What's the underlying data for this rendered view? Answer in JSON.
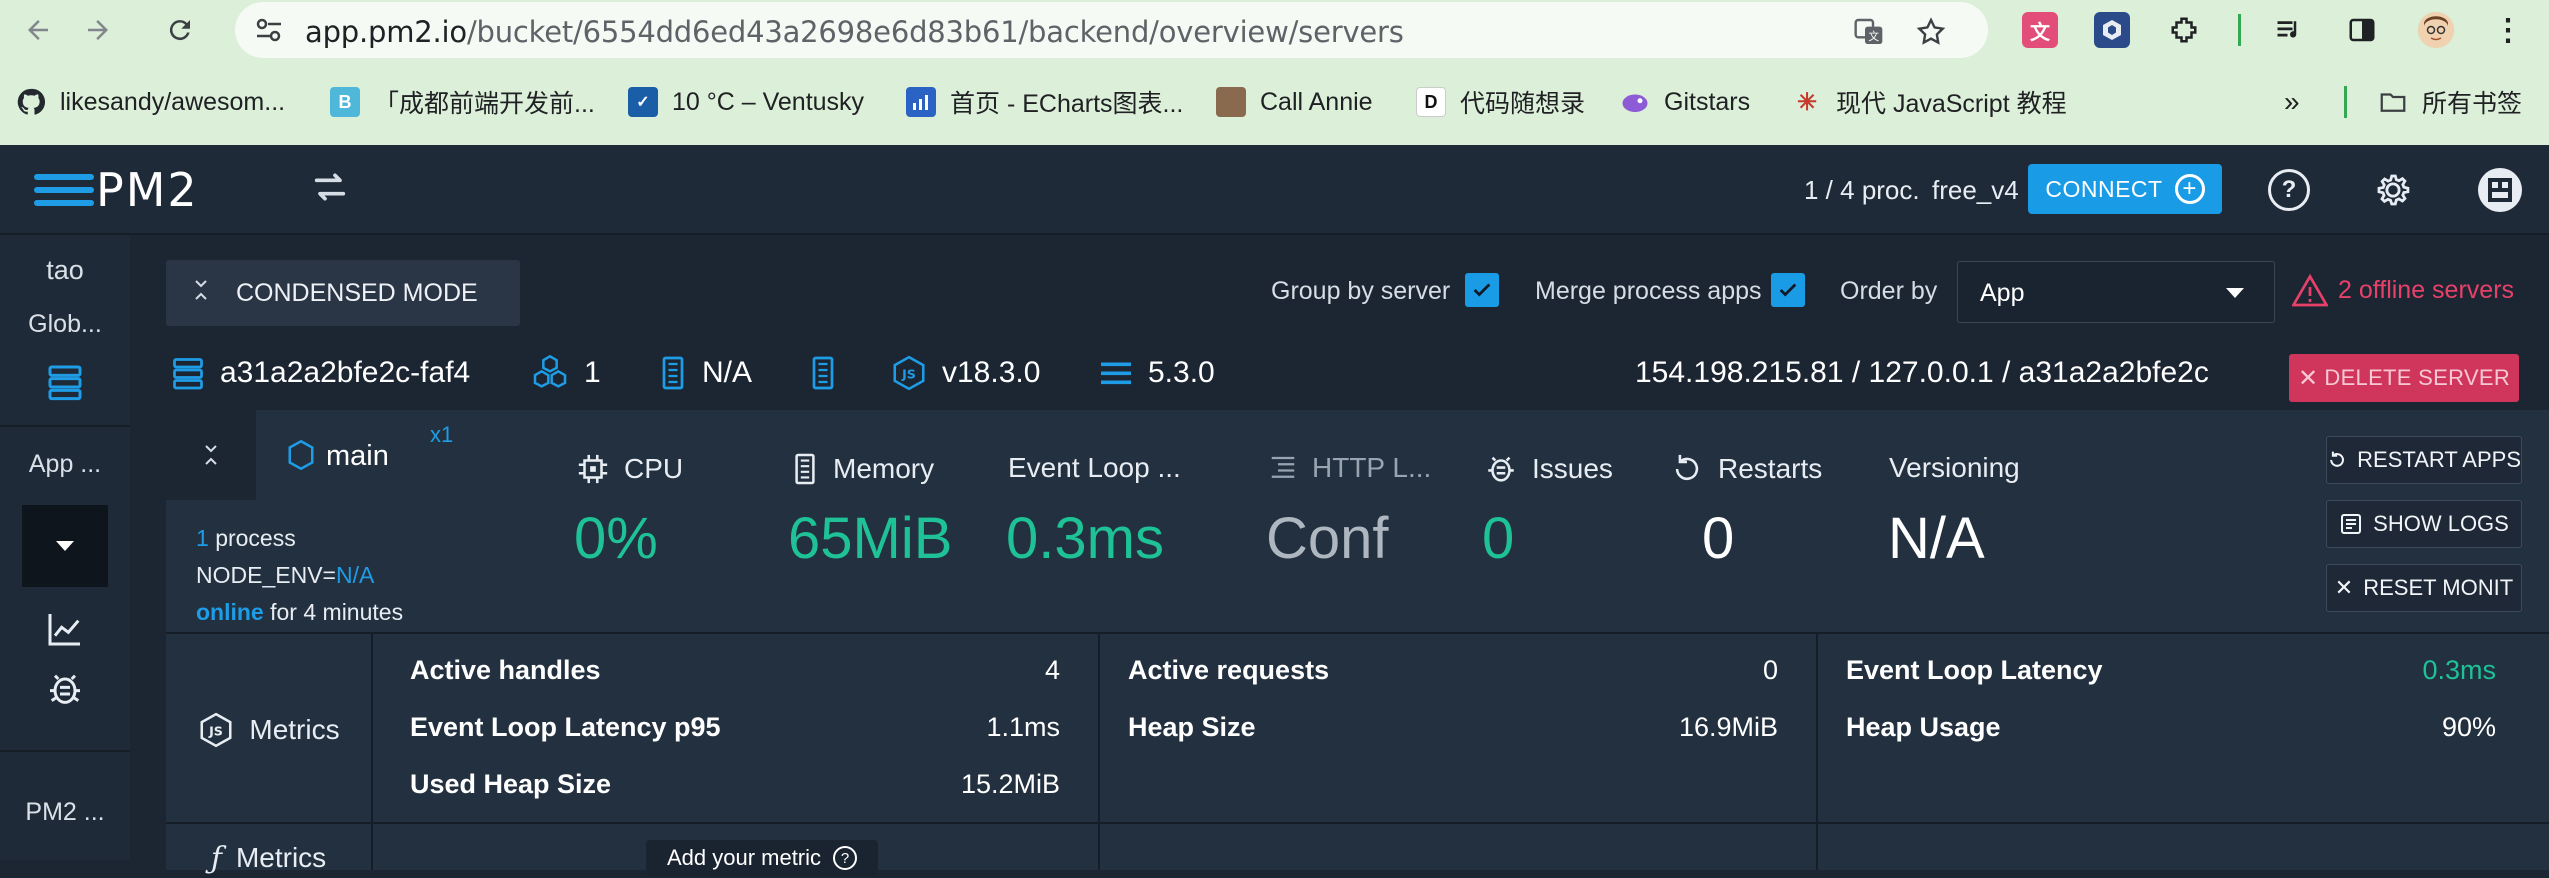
{
  "browser": {
    "url_host": "app.pm2.io",
    "url_path": "/bucket/6554dd6ed43a2698e6d83b61/backend/overview/servers",
    "bookmarks": [
      {
        "label": "likesandy/awesom...",
        "icon": "github-icon",
        "color": "#24292f"
      },
      {
        "label": "「成都前端开发前...",
        "icon": "b-icon",
        "color": "#4fb7d9"
      },
      {
        "label": "10 °C – Ventusky",
        "icon": "ventusky-icon",
        "color": "#1a5ea8"
      },
      {
        "label": "首页 - ECharts图表...",
        "icon": "echarts-icon",
        "color": "#2a63c4"
      },
      {
        "label": "Call Annie",
        "icon": "annie-avatar-icon",
        "color": "#8a6a4e"
      },
      {
        "label": "代码随想录",
        "icon": "d-icon",
        "color": "#111111"
      },
      {
        "label": "Gitstars",
        "icon": "gitstars-icon",
        "color": "#8d5bd6"
      },
      {
        "label": "现代 JavaScript 教程",
        "icon": "js-tutorial-icon",
        "color": "#c7392b"
      }
    ],
    "bookmarks_folder": "所有书签",
    "overflow": "»"
  },
  "header": {
    "logo_text": "PM2",
    "proc_count": "1 / 4 proc.",
    "plan": "free_v4",
    "connect_label": "CONNECT"
  },
  "sidebar": {
    "user": "tao",
    "global": "Glob...",
    "app": "App ...",
    "pm2": "PM2 ..."
  },
  "options": {
    "condensed_label": "CONDENSED MODE",
    "group_by_server": "Group by server",
    "merge_process_apps": "Merge process apps",
    "order_by": "Order by",
    "order_value": "App",
    "offline_servers": "2 offline servers"
  },
  "server": {
    "name": "a31a2a2bfe2c-faf4",
    "instances": "1",
    "host": "N/A",
    "node_version": "v18.3.0",
    "pm2_version": "5.3.0",
    "addresses": "154.198.215.81 / 127.0.0.1 / a31a2a2bfe2c",
    "delete_label": "DELETE SERVER"
  },
  "app": {
    "name": "main",
    "multiplier": "x1",
    "process_count": "1",
    "process_label": "process",
    "env_key": "NODE_ENV=",
    "env_value": "N/A",
    "status": "online",
    "uptime": "for 4 minutes"
  },
  "metrics": [
    {
      "label": "CPU",
      "value": "0%"
    },
    {
      "label": "Memory",
      "value": "65MiB"
    },
    {
      "label": "Event Loop ...",
      "value": "0.3ms"
    },
    {
      "label": "HTTP L...",
      "value": "Conf"
    },
    {
      "label": "Issues",
      "value": "0"
    },
    {
      "label": "Restarts",
      "value": "0"
    },
    {
      "label": "Versioning",
      "value": "N/A"
    }
  ],
  "actions": {
    "restart": "RESTART APPS",
    "logs": "SHOW LOGS",
    "reset": "RESET MONIT"
  },
  "metric_table": {
    "section_label": "Metrics",
    "custom_label": "Metrics",
    "add_metric": "Add your metric",
    "col1": [
      {
        "k": "Active handles",
        "v": "4"
      },
      {
        "k": "Event Loop Latency p95",
        "v": "1.1ms"
      },
      {
        "k": "Used Heap Size",
        "v": "15.2MiB"
      }
    ],
    "col2": [
      {
        "k": "Active requests",
        "v": "0"
      },
      {
        "k": "Heap Size",
        "v": "16.9MiB"
      }
    ],
    "col3": [
      {
        "k": "Event Loop Latency",
        "v": "0.3ms"
      },
      {
        "k": "Heap Usage",
        "v": "90%"
      }
    ]
  },
  "colors": {
    "accent": "#1e9de6",
    "green": "#1ec296",
    "danger": "#e7416a",
    "bg": "#1c2633"
  }
}
